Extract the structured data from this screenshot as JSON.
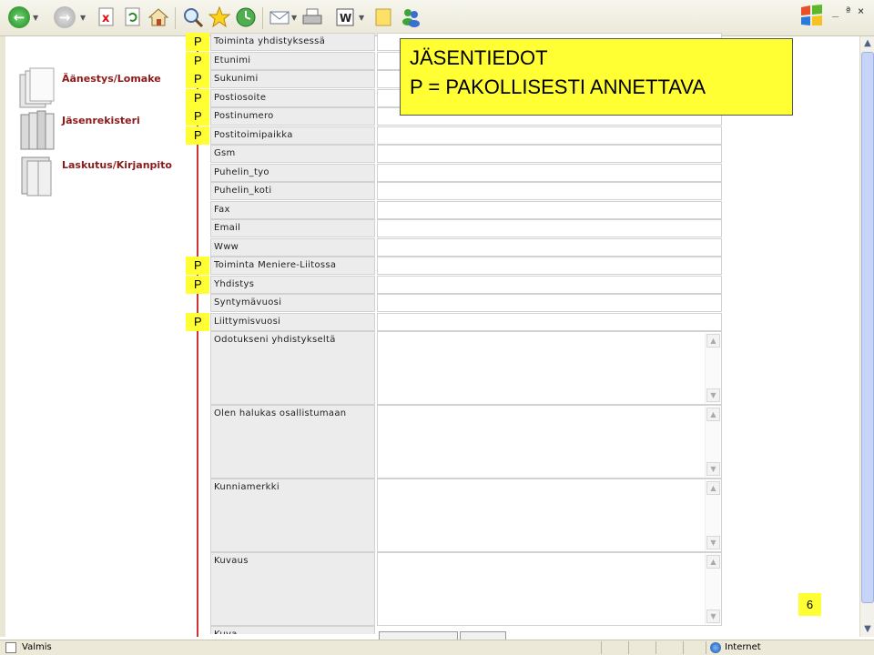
{
  "toolbar": {
    "buttons": [
      {
        "name": "back-button",
        "icon": "back-arrow-icon"
      },
      {
        "name": "forward-button",
        "icon": "forward-arrow-icon"
      },
      {
        "name": "stop-button",
        "icon": "stop-icon"
      },
      {
        "name": "refresh-button",
        "icon": "refresh-icon"
      },
      {
        "name": "home-button",
        "icon": "home-icon"
      },
      {
        "name": "search-button",
        "icon": "magnifier-icon"
      },
      {
        "name": "favorites-button",
        "icon": "star-icon"
      },
      {
        "name": "history-button",
        "icon": "history-icon"
      },
      {
        "name": "mail-button",
        "icon": "mail-icon"
      },
      {
        "name": "print-button",
        "icon": "printer-icon"
      },
      {
        "name": "edit-button",
        "icon": "word-icon"
      },
      {
        "name": "discuss-button",
        "icon": "note-icon"
      },
      {
        "name": "messenger-button",
        "icon": "messenger-icon"
      }
    ],
    "window_controls": [
      "_",
      "ª",
      "×"
    ]
  },
  "sidebar": {
    "items": [
      {
        "label": "Äänestys/Lomake",
        "icon": "documents-icon"
      },
      {
        "label": "Jäsenrekisteri",
        "icon": "binders-icon"
      },
      {
        "label": "Laskutus/Kirjanpito",
        "icon": "folder-icon"
      }
    ]
  },
  "callout": {
    "title": "JÄSENTIEDOT",
    "subtitle": "P = PAKOLLISESTI ANNETTAVA"
  },
  "required_marker": "P",
  "form": {
    "fields": [
      {
        "label": "Toiminta yhdistyksessä",
        "required": true,
        "value": ""
      },
      {
        "label": "Etunimi",
        "required": true,
        "value": ""
      },
      {
        "label": "Sukunimi",
        "required": true,
        "value": ""
      },
      {
        "label": "Postiosoite",
        "required": true,
        "value": ""
      },
      {
        "label": "Postinumero",
        "required": true,
        "value": ""
      },
      {
        "label": "Postitoimipaikka",
        "required": true,
        "value": ""
      },
      {
        "label": "Gsm",
        "required": false,
        "value": ""
      },
      {
        "label": "Puhelin_tyo",
        "required": false,
        "value": ""
      },
      {
        "label": "Puhelin_koti",
        "required": false,
        "value": ""
      },
      {
        "label": "Fax",
        "required": false,
        "value": ""
      },
      {
        "label": "Email",
        "required": false,
        "value": ""
      },
      {
        "label": "Www",
        "required": false,
        "value": ""
      },
      {
        "label": "Toiminta Meniere-Liitossa",
        "required": true,
        "value": ""
      },
      {
        "label": "Yhdistys",
        "required": true,
        "value": ""
      },
      {
        "label": "Syntymävuosi",
        "required": false,
        "value": ""
      },
      {
        "label": "Liittymisvuosi",
        "required": true,
        "value": ""
      }
    ],
    "textareas": [
      {
        "label": "Odotukseni yhdistykseltä",
        "value": ""
      },
      {
        "label": "Olen halukas osallistumaan",
        "value": ""
      },
      {
        "label": "Kunniamerkki",
        "value": ""
      },
      {
        "label": "Kuvaus",
        "value": ""
      }
    ],
    "last_row_label": "Kuva"
  },
  "page_number": "6",
  "statusbar": {
    "status": "Valmis",
    "zone": "Internet"
  }
}
